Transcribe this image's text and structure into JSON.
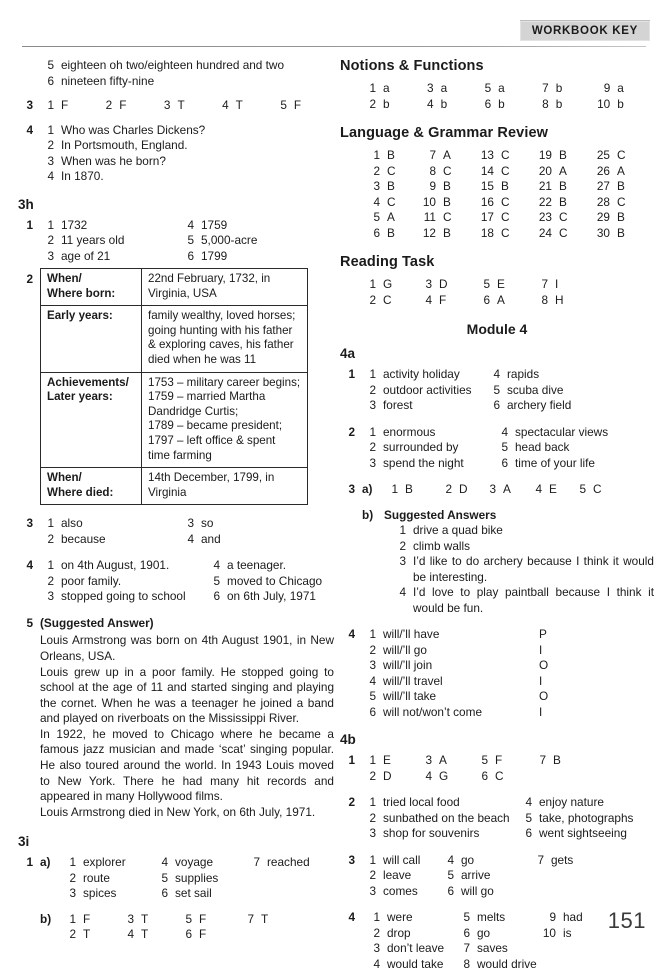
{
  "header": {
    "badge": "WORKBOOK KEY"
  },
  "page_number": "151",
  "left_column": {
    "cont_list": {
      "items": [
        {
          "n": "5",
          "v": "eighteen oh two/eighteen hundred and two"
        },
        {
          "n": "6",
          "v": "nineteen fifty-nine"
        }
      ]
    },
    "ex3": {
      "num": "3",
      "items": [
        {
          "n": "1",
          "v": "F"
        },
        {
          "n": "2",
          "v": "F"
        },
        {
          "n": "3",
          "v": "T"
        },
        {
          "n": "4",
          "v": "T"
        },
        {
          "n": "5",
          "v": "F"
        }
      ]
    },
    "ex4": {
      "num": "4",
      "items": [
        {
          "n": "1",
          "v": "Who was Charles Dickens?"
        },
        {
          "n": "2",
          "v": "In Portsmouth, England."
        },
        {
          "n": "3",
          "v": "When was he born?"
        },
        {
          "n": "4",
          "v": "In 1870."
        }
      ]
    },
    "unit_3h": "3h",
    "h_ex1": {
      "num": "1",
      "col1": [
        {
          "n": "1",
          "v": "1732"
        },
        {
          "n": "2",
          "v": "11 years old"
        },
        {
          "n": "3",
          "v": "age of 21"
        }
      ],
      "col2": [
        {
          "n": "4",
          "v": "1759"
        },
        {
          "n": "5",
          "v": "5,000-acre"
        },
        {
          "n": "6",
          "v": "1799"
        }
      ]
    },
    "h_ex2": {
      "num": "2",
      "rows": [
        {
          "k": "When/\nWhere born:",
          "v": "22nd February, 1732, in\nVirginia, USA"
        },
        {
          "k": "Early years:",
          "v": "family wealthy, loved horses;\ngoing hunting with his father\n& exploring caves, his father\ndied when he was 11"
        },
        {
          "k": "Achievements/\nLater years:",
          "v": "1753 – military career begins;\n1759 – married Martha\nDandridge Curtis;\n1789 – became president;\n1797 – left office & spent\ntime farming"
        },
        {
          "k": "When/\nWhere died:",
          "v": "14th December, 1799, in\nVirginia"
        }
      ]
    },
    "h_ex3": {
      "num": "3",
      "col1": [
        {
          "n": "1",
          "v": "also"
        },
        {
          "n": "2",
          "v": "because"
        }
      ],
      "col2": [
        {
          "n": "3",
          "v": "so"
        },
        {
          "n": "4",
          "v": "and"
        }
      ]
    },
    "h_ex4": {
      "num": "4",
      "col1": [
        {
          "n": "1",
          "v": "on 4th August, 1901."
        },
        {
          "n": "2",
          "v": "poor family."
        },
        {
          "n": "3",
          "v": "stopped going to school"
        }
      ],
      "col2": [
        {
          "n": "4",
          "v": "a teenager."
        },
        {
          "n": "5",
          "v": "moved to Chicago"
        },
        {
          "n": "6",
          "v": "on 6th July, 1971"
        }
      ]
    },
    "h_ex5": {
      "num": "5",
      "heading": "(Suggested Answer)",
      "paragraphs": [
        "Louis Armstrong was born on 4th August 1901, in New Orleans, USA.",
        "Louis grew up in a poor family. He stopped going to school at the age of 11 and started singing and playing the cornet. When he was a teenager he joined a band and played on riverboats on the Mississippi River.",
        "In 1922, he moved to Chicago where he became a famous jazz musician and made ‘scat’ singing popular. He also toured around the world. In 1943 Louis moved to New York. There he had many hit records and appeared in many Hollywood films.",
        "Louis Armstrong died in New York, on 6th July, 1971."
      ]
    },
    "unit_3i": "3i",
    "i_ex1": {
      "num": "1",
      "a_label": "a)",
      "a_col1": [
        {
          "n": "1",
          "v": "explorer"
        },
        {
          "n": "2",
          "v": "route"
        },
        {
          "n": "3",
          "v": "spices"
        }
      ],
      "a_col2": [
        {
          "n": "4",
          "v": "voyage"
        },
        {
          "n": "5",
          "v": "supplies"
        },
        {
          "n": "6",
          "v": "set sail"
        }
      ],
      "a_col3": [
        {
          "n": "7",
          "v": "reached"
        }
      ],
      "b_label": "b)",
      "b_col1": [
        {
          "n": "1",
          "v": "F"
        },
        {
          "n": "2",
          "v": "T"
        }
      ],
      "b_col2": [
        {
          "n": "3",
          "v": "T"
        },
        {
          "n": "4",
          "v": "T"
        }
      ],
      "b_col3": [
        {
          "n": "5",
          "v": "F"
        },
        {
          "n": "6",
          "v": "F"
        }
      ],
      "b_col4": [
        {
          "n": "7",
          "v": "T"
        }
      ]
    }
  },
  "right_column": {
    "notions_title": "Notions & Functions",
    "notions": {
      "col1": [
        {
          "n": "1",
          "v": "a"
        },
        {
          "n": "2",
          "v": "b"
        }
      ],
      "col2": [
        {
          "n": "3",
          "v": "a"
        },
        {
          "n": "4",
          "v": "b"
        }
      ],
      "col3": [
        {
          "n": "5",
          "v": "a"
        },
        {
          "n": "6",
          "v": "b"
        }
      ],
      "col4": [
        {
          "n": "7",
          "v": "b"
        },
        {
          "n": "8",
          "v": "b"
        }
      ],
      "col5": [
        {
          "n": "9",
          "v": "a"
        },
        {
          "n": "10",
          "v": "b"
        }
      ]
    },
    "lgr_title": "Language & Grammar Review",
    "lgr": {
      "col1": [
        {
          "n": "1",
          "v": "B"
        },
        {
          "n": "2",
          "v": "C"
        },
        {
          "n": "3",
          "v": "B"
        },
        {
          "n": "4",
          "v": "C"
        },
        {
          "n": "5",
          "v": "A"
        },
        {
          "n": "6",
          "v": "B"
        }
      ],
      "col2": [
        {
          "n": "7",
          "v": "A"
        },
        {
          "n": "8",
          "v": "C"
        },
        {
          "n": "9",
          "v": "B"
        },
        {
          "n": "10",
          "v": "B"
        },
        {
          "n": "11",
          "v": "C"
        },
        {
          "n": "12",
          "v": "B"
        }
      ],
      "col3": [
        {
          "n": "13",
          "v": "C"
        },
        {
          "n": "14",
          "v": "C"
        },
        {
          "n": "15",
          "v": "B"
        },
        {
          "n": "16",
          "v": "C"
        },
        {
          "n": "17",
          "v": "C"
        },
        {
          "n": "18",
          "v": "C"
        }
      ],
      "col4": [
        {
          "n": "19",
          "v": "B"
        },
        {
          "n": "20",
          "v": "A"
        },
        {
          "n": "21",
          "v": "B"
        },
        {
          "n": "22",
          "v": "B"
        },
        {
          "n": "23",
          "v": "C"
        },
        {
          "n": "24",
          "v": "C"
        }
      ],
      "col5": [
        {
          "n": "25",
          "v": "C"
        },
        {
          "n": "26",
          "v": "A"
        },
        {
          "n": "27",
          "v": "B"
        },
        {
          "n": "28",
          "v": "C"
        },
        {
          "n": "29",
          "v": "B"
        },
        {
          "n": "30",
          "v": "B"
        }
      ]
    },
    "reading_title": "Reading Task",
    "reading": {
      "col1": [
        {
          "n": "1",
          "v": "G"
        },
        {
          "n": "2",
          "v": "C"
        }
      ],
      "col2": [
        {
          "n": "3",
          "v": "D"
        },
        {
          "n": "4",
          "v": "F"
        }
      ],
      "col3": [
        {
          "n": "5",
          "v": "E"
        },
        {
          "n": "6",
          "v": "A"
        }
      ],
      "col4": [
        {
          "n": "7",
          "v": "I"
        },
        {
          "n": "8",
          "v": "H"
        }
      ]
    },
    "module_title": "Module 4",
    "unit_4a": "4a",
    "a_ex1": {
      "num": "1",
      "col1": [
        {
          "n": "1",
          "v": "activity holiday"
        },
        {
          "n": "2",
          "v": "outdoor activities"
        },
        {
          "n": "3",
          "v": "forest"
        }
      ],
      "col2": [
        {
          "n": "4",
          "v": "rapids"
        },
        {
          "n": "5",
          "v": "scuba dive"
        },
        {
          "n": "6",
          "v": "archery field"
        }
      ]
    },
    "a_ex2": {
      "num": "2",
      "col1": [
        {
          "n": "1",
          "v": "enormous"
        },
        {
          "n": "2",
          "v": "surrounded by"
        },
        {
          "n": "3",
          "v": "spend the night"
        }
      ],
      "col2": [
        {
          "n": "4",
          "v": "spectacular views"
        },
        {
          "n": "5",
          "v": "head back"
        },
        {
          "n": "6",
          "v": "time of your life"
        }
      ]
    },
    "a_ex3": {
      "num": "3",
      "a_label": "a)",
      "a_items": [
        {
          "n": "1",
          "v": "B"
        },
        {
          "n": "2",
          "v": "D"
        },
        {
          "n": "3",
          "v": "A"
        },
        {
          "n": "4",
          "v": "E"
        },
        {
          "n": "5",
          "v": "C"
        }
      ],
      "b_label": "b)",
      "b_heading": "Suggested Answers",
      "b_items": [
        {
          "n": "1",
          "v": "drive a quad bike"
        },
        {
          "n": "2",
          "v": "climb walls"
        },
        {
          "n": "3",
          "v": "I’d like to do archery because I think it would be interesting."
        },
        {
          "n": "4",
          "v": "I’d love to play paintball because I think it would be fun."
        }
      ]
    },
    "a_ex4": {
      "num": "4",
      "items": [
        {
          "n": "1",
          "v": "will/’ll have",
          "tag": "P"
        },
        {
          "n": "2",
          "v": "will/’ll go",
          "tag": "I"
        },
        {
          "n": "3",
          "v": "will/’ll join",
          "tag": "O"
        },
        {
          "n": "4",
          "v": "will/’ll travel",
          "tag": "I"
        },
        {
          "n": "5",
          "v": "will/’ll take",
          "tag": "O"
        },
        {
          "n": "6",
          "v": "will not/won’t come",
          "tag": "I"
        }
      ]
    },
    "unit_4b": "4b",
    "b_ex1": {
      "num": "1",
      "col1": [
        {
          "n": "1",
          "v": "E"
        },
        {
          "n": "2",
          "v": "D"
        }
      ],
      "col2": [
        {
          "n": "3",
          "v": "A"
        },
        {
          "n": "4",
          "v": "G"
        }
      ],
      "col3": [
        {
          "n": "5",
          "v": "F"
        },
        {
          "n": "6",
          "v": "C"
        }
      ],
      "col4": [
        {
          "n": "7",
          "v": "B"
        }
      ]
    },
    "b_ex2": {
      "num": "2",
      "col1": [
        {
          "n": "1",
          "v": "tried local food"
        },
        {
          "n": "2",
          "v": "sunbathed on the beach"
        },
        {
          "n": "3",
          "v": "shop for souvenirs"
        }
      ],
      "col2": [
        {
          "n": "4",
          "v": "enjoy nature"
        },
        {
          "n": "5",
          "v": "take, photographs"
        },
        {
          "n": "6",
          "v": "went sightseeing"
        }
      ]
    },
    "b_ex3": {
      "num": "3",
      "col1": [
        {
          "n": "1",
          "v": "will call"
        },
        {
          "n": "2",
          "v": "leave"
        },
        {
          "n": "3",
          "v": "comes"
        }
      ],
      "col2": [
        {
          "n": "4",
          "v": "go"
        },
        {
          "n": "5",
          "v": "arrive"
        },
        {
          "n": "6",
          "v": "will go"
        }
      ],
      "col3": [
        {
          "n": "7",
          "v": "gets"
        }
      ]
    },
    "b_ex4": {
      "num": "4",
      "col1": [
        {
          "n": "1",
          "v": "were"
        },
        {
          "n": "2",
          "v": "drop"
        },
        {
          "n": "3",
          "v": "don’t leave"
        },
        {
          "n": "4",
          "v": "would take"
        }
      ],
      "col2": [
        {
          "n": "5",
          "v": "melts"
        },
        {
          "n": "6",
          "v": "go"
        },
        {
          "n": "7",
          "v": "saves"
        },
        {
          "n": "8",
          "v": "would drive"
        }
      ],
      "col3": [
        {
          "n": "9",
          "v": "had"
        },
        {
          "n": "10",
          "v": "is"
        }
      ]
    }
  }
}
